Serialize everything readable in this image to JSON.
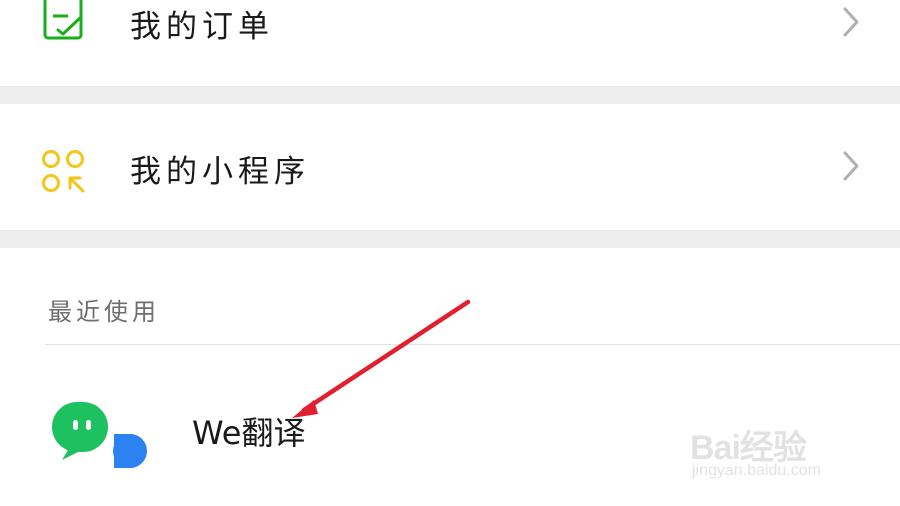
{
  "menu": {
    "orders": {
      "label": "我的订单",
      "icon": "order-checklist-icon",
      "icon_color": "#1aad19"
    },
    "mini_programs": {
      "label": "我的小程序",
      "icon": "mini-program-icon",
      "icon_color": "#f5c518"
    },
    "chevron_icon": "chevron-right-icon"
  },
  "recent": {
    "section_title": "最近使用",
    "items": [
      {
        "name": "We翻译",
        "icon": "we-translate-app-icon",
        "icon_colors": [
          "#1ec15f",
          "#2b82f0"
        ]
      }
    ]
  },
  "annotation": {
    "type": "red-arrow",
    "color": "#e0202e",
    "points_to": "We翻译"
  },
  "watermark": {
    "brand": "Bai经验",
    "url": "jingyan.baidu.com"
  },
  "colors": {
    "section_gap": "#ededed",
    "divider": "#e3e3e3",
    "text_primary": "#1a1a1a",
    "text_secondary": "#6e6e6e"
  }
}
